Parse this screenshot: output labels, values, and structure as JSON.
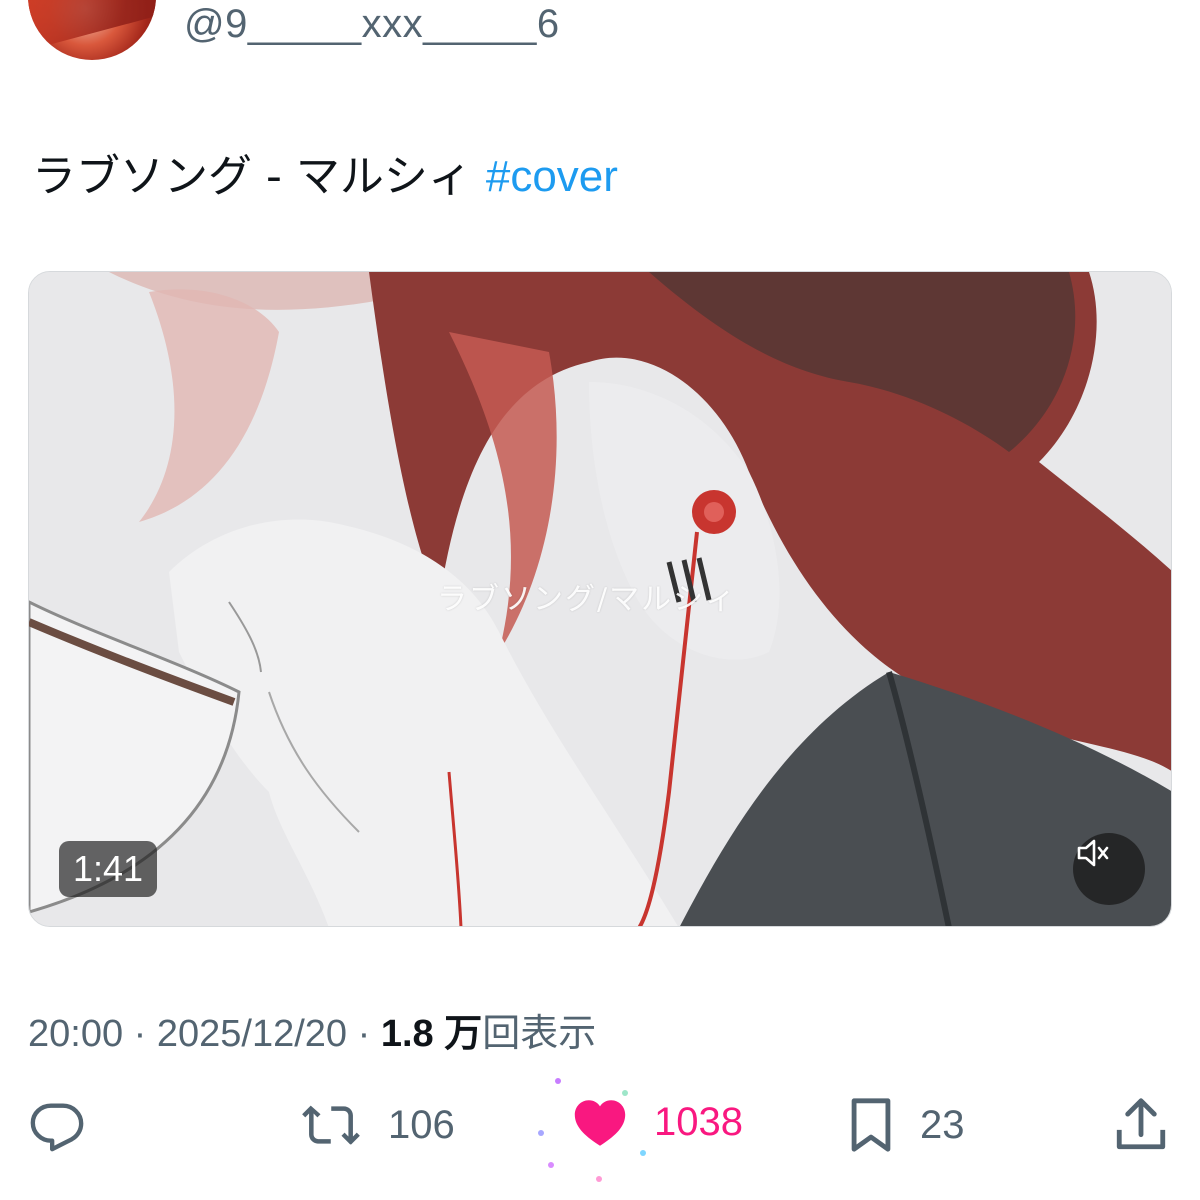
{
  "header": {
    "handle": "@9_____xxx_____6",
    "avatar_icon": "user-avatar"
  },
  "tweet": {
    "text": "ラブソング - マルシィ ",
    "hashtag": "#cover"
  },
  "media": {
    "caption_overlay": "ラブソング/マルシィ",
    "duration": "1:41",
    "mute_icon": "speaker-muted-icon"
  },
  "meta": {
    "time": "20:00",
    "separator": " · ",
    "date": "2025/12/20",
    "views_value": "1.8 万",
    "views_label": "回表示"
  },
  "actions": {
    "reply_icon": "reply-icon",
    "retweet_icon": "retweet-icon",
    "retweet_count": "106",
    "like_icon": "heart-icon",
    "like_count": "1038",
    "bookmark_icon": "bookmark-icon",
    "bookmark_count": "23",
    "share_icon": "share-icon"
  },
  "colors": {
    "link": "#1d9bf0",
    "like": "#f91880",
    "secondary_text": "#536471",
    "primary_text": "#0f1419"
  }
}
